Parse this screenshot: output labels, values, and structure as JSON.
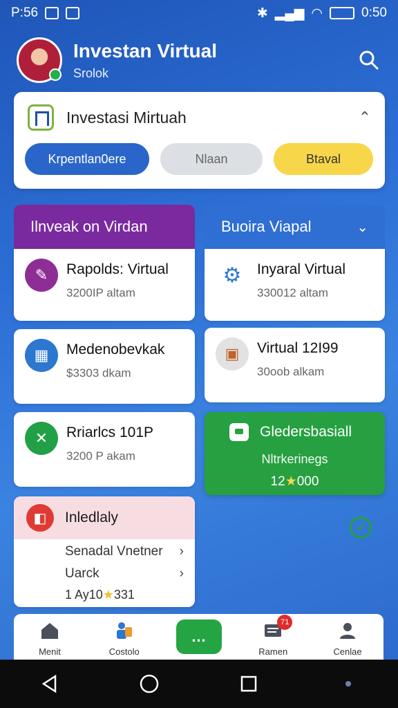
{
  "status": {
    "time_left": "P:56",
    "time_right": "0:50"
  },
  "header": {
    "title": "Investan Virtual",
    "subtitle": "Srolok"
  },
  "topcard": {
    "title": "Investasi Mirtuah",
    "buttons": [
      "Krpentlan0ere",
      "Nlaan",
      "Btaval"
    ]
  },
  "left_column": {
    "title": "Ilnveak on Virdan",
    "items": [
      {
        "title": "Rapolds: Virtual",
        "subtitle": "3200IP altam",
        "icon": "edit-icon",
        "color": "#8e2e95"
      },
      {
        "title": "Medenobevkak",
        "subtitle": "$3303 dkam",
        "icon": "calendar-icon",
        "color": "#2c77d0"
      },
      {
        "title": "Rriarlcs 101P",
        "subtitle": "3200 P akam",
        "icon": "tools-icon",
        "color": "#22a045"
      }
    ]
  },
  "right_column": {
    "title": "Buoira Viapal",
    "items": [
      {
        "title": "Inyaral Virtual",
        "subtitle": "330012 altam",
        "icon": "group-icon",
        "color": "#2c77d0"
      },
      {
        "title": "Virtual 12I99",
        "subtitle": "30oob alkam",
        "icon": "app-icon",
        "color": "#e2e2e2"
      }
    ]
  },
  "green_card": {
    "title": "Gledersbasiall",
    "subtitle": "Nltrkerinegs",
    "value_pre": "12",
    "value_post": "000"
  },
  "lower_card": {
    "title": "Inledlaly",
    "rows": [
      "Senadal Vnetner",
      "Uarck"
    ],
    "value_pre": "1 Ay10",
    "value_post": "331"
  },
  "bottom_nav": {
    "items": [
      "Menit",
      "Costolo",
      "Ramen",
      "Cenlae"
    ],
    "center_label": "…",
    "badge": "71"
  }
}
